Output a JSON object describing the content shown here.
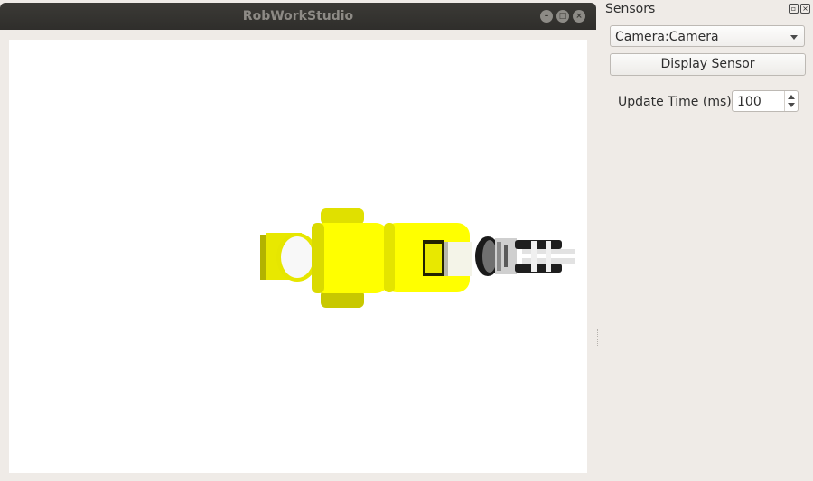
{
  "window": {
    "title": "RobWorkStudio",
    "controls": [
      "minimize-icon",
      "maximize-icon",
      "close-icon"
    ]
  },
  "dock": {
    "title": "Sensors",
    "buttons": [
      "float-icon",
      "close-icon"
    ],
    "sensor_select": {
      "value": "Camera:Camera"
    },
    "display_button": "Display Sensor",
    "update_time": {
      "label": "Update Time (ms)",
      "value": "100"
    }
  },
  "scene": {
    "description_colors": {
      "robot_body": "#ffff00",
      "background": "#ffffff",
      "gripper": "#111111"
    }
  }
}
